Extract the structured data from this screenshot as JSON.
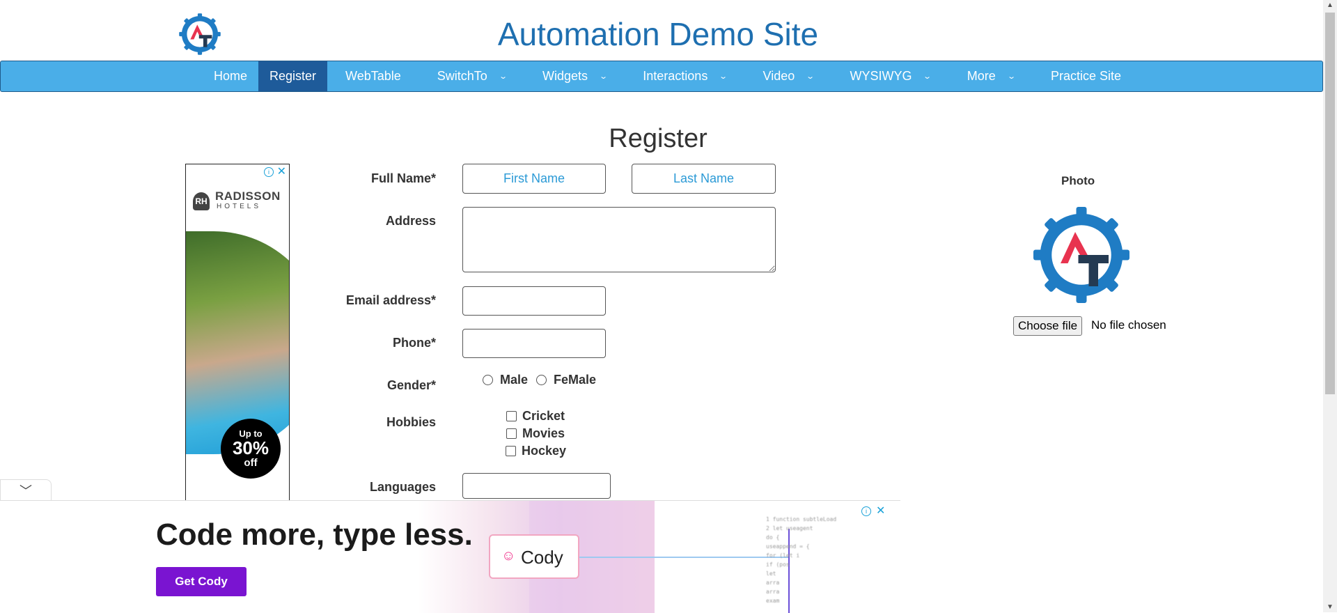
{
  "header": {
    "title": "Automation Demo Site",
    "logo_text": "AT"
  },
  "nav": {
    "items": [
      {
        "label": "Home",
        "dropdown": false
      },
      {
        "label": "Register",
        "dropdown": false,
        "active": true
      },
      {
        "label": "WebTable",
        "dropdown": false
      },
      {
        "label": "SwitchTo",
        "dropdown": true
      },
      {
        "label": "Widgets",
        "dropdown": true
      },
      {
        "label": "Interactions",
        "dropdown": true
      },
      {
        "label": "Video",
        "dropdown": true
      },
      {
        "label": "WYSIWYG",
        "dropdown": true
      },
      {
        "label": "More",
        "dropdown": true
      },
      {
        "label": "Practice Site",
        "dropdown": false
      }
    ]
  },
  "form": {
    "heading": "Register",
    "full_name_label": "Full Name*",
    "first_name_placeholder": "First Name",
    "last_name_placeholder": "Last Name",
    "address_label": "Address",
    "email_label": "Email address*",
    "phone_label": "Phone*",
    "gender_label": "Gender*",
    "gender_options": [
      "Male",
      "FeMale"
    ],
    "hobbies_label": "Hobbies",
    "hobbies": [
      "Cricket",
      "Movies",
      "Hockey"
    ],
    "languages_label": "Languages"
  },
  "photo": {
    "label": "Photo",
    "button": "Choose file",
    "status": "No file chosen"
  },
  "side_ad": {
    "brand_badge": "RH",
    "brand_name": "RADISSON",
    "brand_sub": "HOTELS",
    "promo_line1": "Up to",
    "promo_line2": "30%",
    "promo_line3": "off"
  },
  "bottom_ad": {
    "headline": "Code more, type less.",
    "cta": "Get Cody",
    "product": "Cody",
    "code_lines": [
      "1   function subtleLoad",
      "2     let useagent",
      "      do {",
      "        useappend = {",
      "        for (let i",
      "          if (pos",
      "            let",
      "            arra",
      "            arra",
      "            exam"
    ]
  },
  "colors": {
    "nav_bg": "#4aaee8",
    "nav_active": "#1e5b9a",
    "title": "#1e6fb0",
    "placeholder": "#2b9ad6",
    "cta": "#7a14d1"
  }
}
